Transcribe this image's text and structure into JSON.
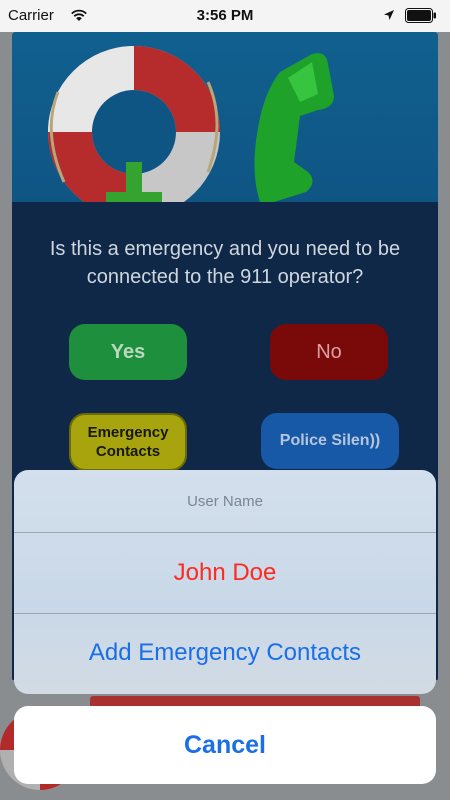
{
  "status_bar": {
    "carrier": "Carrier",
    "time": "3:56 PM"
  },
  "background_screen": {
    "question": "Is this a emergency and you need to be connected to the 911 operator?",
    "buttons": {
      "yes": "Yes",
      "no": "No",
      "emergency_contacts": "Emergency Contacts",
      "police_siren": "Police Silen))"
    },
    "colors": {
      "yes": "#1e8f3c",
      "no": "#7a0a0a",
      "emergency_contacts": "#a7a40d",
      "police_siren": "#1759a7"
    },
    "icons": [
      "life-ring-icon",
      "phone-handset-icon"
    ]
  },
  "action_sheet": {
    "title": "User Name",
    "actions": [
      {
        "label": "John Doe",
        "style": "destructive",
        "color": "#ff2a1f"
      },
      {
        "label": "Add Emergency Contacts",
        "style": "default",
        "color": "#1a6fe6"
      }
    ],
    "cancel_label": "Cancel"
  }
}
